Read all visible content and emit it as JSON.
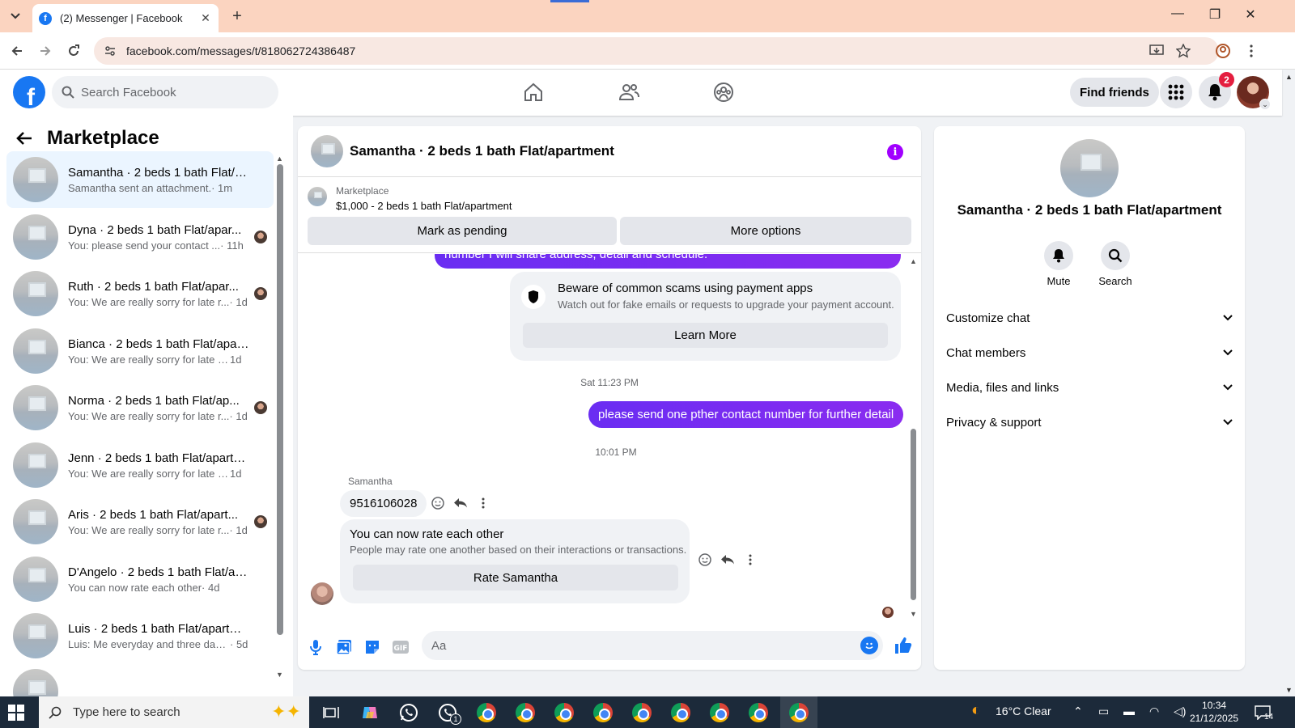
{
  "browser": {
    "tab_title": "(2) Messenger | Facebook",
    "url": "facebook.com/messages/t/818062724386487"
  },
  "fb_header": {
    "search_placeholder": "Search Facebook",
    "find_friends_label": "Find friends",
    "notification_count": "2"
  },
  "sidebar": {
    "title": "Marketplace",
    "conversations": [
      {
        "name": "Samantha · 2 beds 1 bath Flat/a...",
        "snippet": "Samantha sent an attachment.",
        "time": " · 1m",
        "active": true
      },
      {
        "name": "Dyna · 2 beds 1 bath Flat/apar...",
        "snippet": "You: please send your contact ...",
        "time": " · 11h"
      },
      {
        "name": "Ruth · 2 beds 1 bath Flat/apar...",
        "snippet": "You: We are really sorry for late r...",
        "time": " · 1d"
      },
      {
        "name": "Bianca · 2 beds 1 bath Flat/apart...",
        "snippet": "You: We are really sorry for late repl...",
        "time": " 1d"
      },
      {
        "name": "Norma · 2 beds 1 bath Flat/ap...",
        "snippet": "You: We are really sorry for late r...",
        "time": " · 1d"
      },
      {
        "name": "Jenn · 2 beds 1 bath Flat/apartm...",
        "snippet": "You: We are really sorry for late repl...",
        "time": " 1d"
      },
      {
        "name": "Aris · 2 beds 1 bath Flat/apart...",
        "snippet": "You: We are really sorry for late r...",
        "time": " · 1d"
      },
      {
        "name": "D'Angelo · 2 beds 1 bath Flat/ap...",
        "snippet": "You can now rate each other",
        "time": " · 4d"
      },
      {
        "name": "Luis · 2 beds 1 bath Flat/apartme...",
        "snippet": "Luis: Me everyday and three daugh...",
        "time": " · 5d"
      }
    ]
  },
  "chat": {
    "title": "Samantha · 2 beds 1 bath Flat/apartment",
    "marketplace_label": "Marketplace",
    "listing": "$1,000 - 2 beds 1 bath Flat/apartment",
    "mark_pending_label": "Mark as pending",
    "more_options_label": "More options",
    "partial_message": "number I will share address, detail and schedule.",
    "scam_title": "Beware of common scams using payment apps",
    "scam_sub": "Watch out for fake emails or requests to upgrade your payment account.",
    "learn_more_label": "Learn More",
    "timestamp_1": "Sat 11:23 PM",
    "outgoing_message": "please send one pther contact number for further detail",
    "timestamp_2": "10:01 PM",
    "sender_name": "Samantha",
    "incoming_message": "9516106028",
    "rate_title": "You can now rate each other",
    "rate_sub": "People may rate one another based on their interactions or transactions.",
    "rate_button_label": "Rate Samantha",
    "composer_placeholder": "Aa"
  },
  "right_panel": {
    "name": "Samantha · 2 beds 1 bath Flat/apartment",
    "mute_label": "Mute",
    "search_label": "Search",
    "sections": [
      "Customize chat",
      "Chat members",
      "Media, files and links",
      "Privacy & support"
    ]
  },
  "taskbar": {
    "search_placeholder": "Type here to search",
    "weather": "16°C  Clear",
    "time": "10:34",
    "date": "21/12/2025",
    "notification_count": "14",
    "whatsapp_badge": "1"
  },
  "colors": {
    "accent": "#1877f2",
    "outgoing_bubble": "#7b2cf0",
    "info_button": "#a100ff",
    "tabbar": "#fbd4c0"
  }
}
